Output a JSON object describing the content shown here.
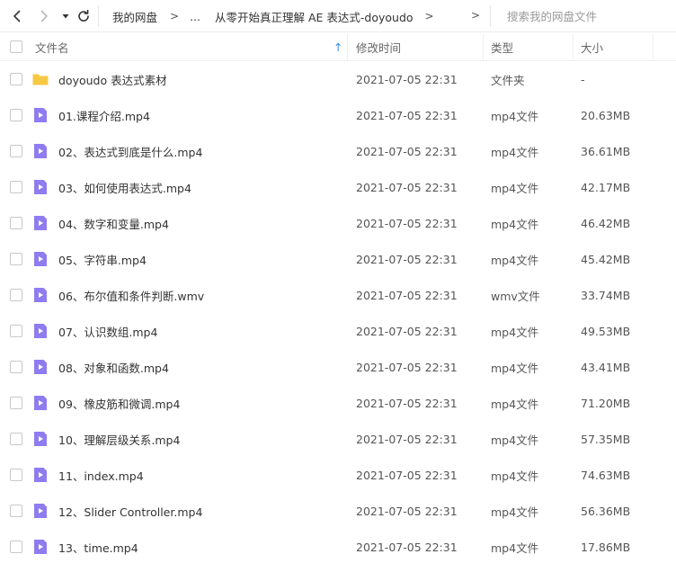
{
  "toolbar": {
    "breadcrumb": [
      "我的网盘",
      "...",
      "从零开始真正理解 AE 表达式-doyoudo"
    ],
    "crumb_separator": ">",
    "search_placeholder": "搜索我的网盘文件"
  },
  "columns": {
    "name": "文件名",
    "sort_indicator": "↑",
    "modified": "修改时间",
    "type": "类型",
    "size": "大小"
  },
  "files": [
    {
      "name": "doyoudo 表达式素材",
      "modified": "2021-07-05 22:31",
      "type": "文件夹",
      "size": "-",
      "icon": "folder-icon"
    },
    {
      "name": "01.课程介绍.mp4",
      "modified": "2021-07-05 22:31",
      "type": "mp4文件",
      "size": "20.63MB",
      "icon": "video-file-icon"
    },
    {
      "name": "02、表达式到底是什么.mp4",
      "modified": "2021-07-05 22:31",
      "type": "mp4文件",
      "size": "36.61MB",
      "icon": "video-file-icon"
    },
    {
      "name": "03、如何使用表达式.mp4",
      "modified": "2021-07-05 22:31",
      "type": "mp4文件",
      "size": "42.17MB",
      "icon": "video-file-icon"
    },
    {
      "name": "04、数字和变量.mp4",
      "modified": "2021-07-05 22:31",
      "type": "mp4文件",
      "size": "46.42MB",
      "icon": "video-file-icon"
    },
    {
      "name": "05、字符串.mp4",
      "modified": "2021-07-05 22:31",
      "type": "mp4文件",
      "size": "45.42MB",
      "icon": "video-file-icon"
    },
    {
      "name": "06、布尔值和条件判断.wmv",
      "modified": "2021-07-05 22:31",
      "type": "wmv文件",
      "size": "33.74MB",
      "icon": "video-file-icon"
    },
    {
      "name": "07、认识数组.mp4",
      "modified": "2021-07-05 22:31",
      "type": "mp4文件",
      "size": "49.53MB",
      "icon": "video-file-icon"
    },
    {
      "name": "08、对象和函数.mp4",
      "modified": "2021-07-05 22:31",
      "type": "mp4文件",
      "size": "43.41MB",
      "icon": "video-file-icon"
    },
    {
      "name": "09、橡皮筋和微调.mp4",
      "modified": "2021-07-05 22:31",
      "type": "mp4文件",
      "size": "71.20MB",
      "icon": "video-file-icon"
    },
    {
      "name": "10、理解层级关系.mp4",
      "modified": "2021-07-05 22:31",
      "type": "mp4文件",
      "size": "57.35MB",
      "icon": "video-file-icon"
    },
    {
      "name": "11、index.mp4",
      "modified": "2021-07-05 22:31",
      "type": "mp4文件",
      "size": "74.63MB",
      "icon": "video-file-icon"
    },
    {
      "name": "12、Slider Controller.mp4",
      "modified": "2021-07-05 22:31",
      "type": "mp4文件",
      "size": "56.36MB",
      "icon": "video-file-icon"
    },
    {
      "name": "13、time.mp4",
      "modified": "2021-07-05 22:31",
      "type": "mp4文件",
      "size": "17.86MB",
      "icon": "video-file-icon"
    }
  ],
  "colors": {
    "video_icon": "#8f7cf0",
    "folder_icon": "#f7c843",
    "sort_arrow": "#2f8ff5"
  }
}
